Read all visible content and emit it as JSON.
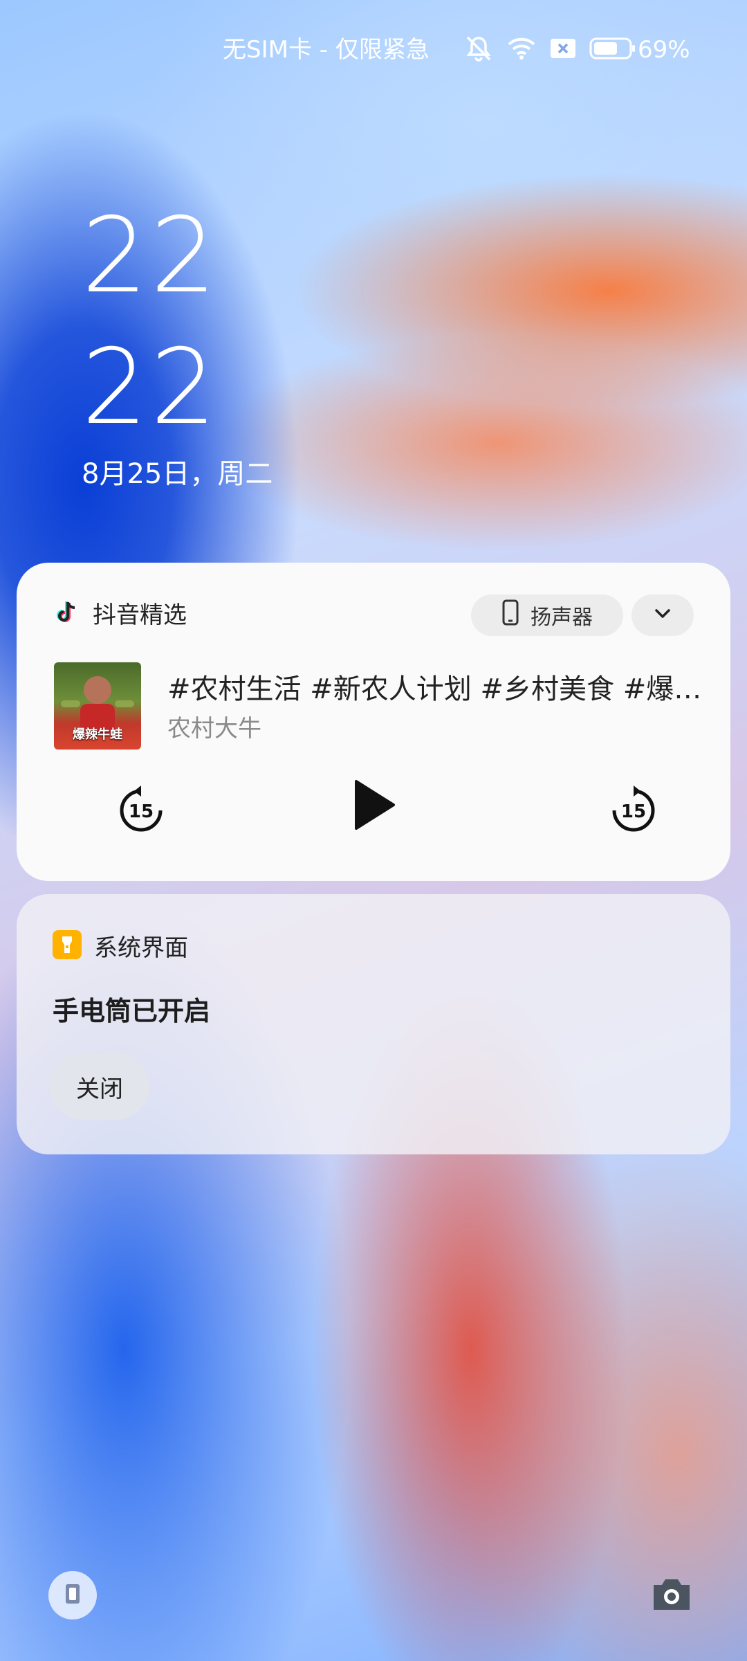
{
  "status_bar": {
    "carrier": "无SIM卡 - 仅限紧急",
    "battery": "69%",
    "icons": [
      "mute-icon",
      "wifi-icon",
      "no-sim-icon",
      "battery-icon"
    ]
  },
  "lockscreen": {
    "hour": "22",
    "minute": "22",
    "date": "8月25日，周二"
  },
  "media": {
    "app_name": "抖音精选",
    "output_label": "扬声器",
    "title": "#农村生活 #新农人计划 #乡村美食 #爆辣牛蛙",
    "artist": "农村大牛",
    "thumb_text": "爆辣牛蛙",
    "rewind_label": "15",
    "forward_label": "15"
  },
  "system": {
    "app_name": "系统界面",
    "title": "手电筒已开启",
    "close_label": "关闭"
  },
  "colors": {
    "flashlight_accent": "#FFB300",
    "tiktok_cyan": "#25F4EE",
    "tiktok_red": "#FE2C55"
  }
}
